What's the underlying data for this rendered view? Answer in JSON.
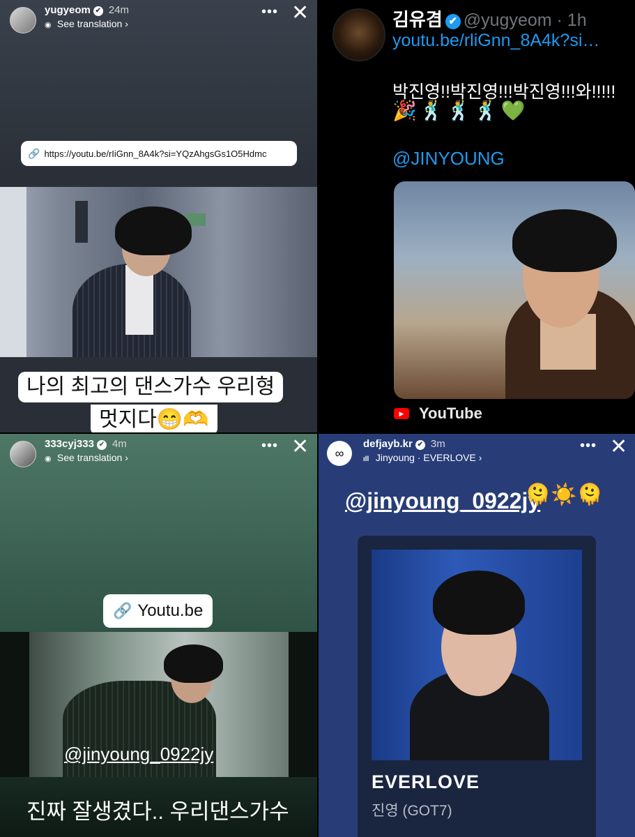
{
  "story1": {
    "username": "yugyeom",
    "time": "24m",
    "subtitle": "See translation",
    "link_text": "https://youtu.be/rIiGnn_8A4k?si=YQzAhgsGs1O5Hdmc",
    "caption_line1": "나의 최고의 댄스가수 우리형",
    "caption_line2": "멋지다😁🫶",
    "more": "•••",
    "close": "✕"
  },
  "tweet": {
    "display_name": "김유겸",
    "handle": "@yugyeom · 1h",
    "link": "youtu.be/rliGnn_8A4k?si…",
    "text": "박진영!!박진영!!!박진영!!!와!!!!!",
    "emoji_line": "🎉🕺🕺🕺💚",
    "mention": "@JINYOUNG",
    "source": "YouTube"
  },
  "story3": {
    "username": "333cyj333",
    "time": "4m",
    "subtitle": "See translation",
    "link_text": "Youtu.be",
    "photo_tag": "@jinyoung_0922jy",
    "caption": "진짜 잘생겼다.. 우리댄스가수",
    "more": "•••",
    "close": "✕"
  },
  "story4": {
    "username": "defjayb.kr",
    "time": "3m",
    "music": "Jinyoung · EVERLOVE",
    "mention": "@jinyoung_0922jy",
    "emoji": "🫠☀️🫠",
    "song_title": "EVERLOVE",
    "song_artist": "진영 (GOT7)",
    "more": "•••",
    "close": "✕"
  },
  "icons": {
    "verified": "✔",
    "chevron": "›",
    "translate": "◉",
    "link": "🔗",
    "music_bars": "ıll",
    "youtube_play": "▶"
  }
}
